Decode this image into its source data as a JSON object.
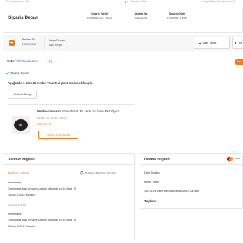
{
  "topbar": {
    "left": "Tüm Siparişlerine Dön",
    "middle": "Siparişini Göle",
    "right": "Hesaplı Sanş Siparişlerinize Gi"
  },
  "page_title": "Sipariş Detayı",
  "summary": {
    "date_label": "Sipariş Tarihi",
    "date_value": "19 Aralık 2023 - 01:25",
    "order_no_label": "Sipariş No",
    "order_no_value": "905244749",
    "summary_label": "Sipariş Özeti",
    "summary_value": "1 Teslimat, 1 Ürün"
  },
  "package": {
    "delivery_no_label": "Teslimat No",
    "delivery_no_value": "3122087545",
    "carrier_label": "Kargo Firması",
    "carrier_value": "Aras Kargo",
    "return_button": "İade Talebi",
    "side_button": "Fa"
  },
  "seller": {
    "label": "Satıcı:",
    "name": "Modaadresiniz",
    "badge": "9,8",
    "action_badge": "Satı"
  },
  "status": {
    "text": "Teslim Edildi",
    "info": "Aşağıdaki 1 ürün 25 Aralık Pazartesi günü teslim edilmiştir.",
    "detail_button": "Teslimat Detay"
  },
  "product": {
    "brand": "Modaadresiniz",
    "title": "Uncharted 4: Bir Hırsızın Sonu Ps4 Oyun...",
    "attributes": "Beden: Gri, 40-46 - Adet: 1",
    "price": "199,90 TL",
    "evaluate_button": "Ürünü Değerlendir"
  },
  "delivery_info": {
    "heading": "Teslimat Bilgileri",
    "address_heading": "Teslimat Adresi",
    "update_link": "Teslimat Adresini Güncelle",
    "name": "emine kaya",
    "line1": "Dumlupınar Mah prevaze caddesi 48 sokak no 16 daire 19",
    "line2": "Gölcük 41000 / Kocaeli",
    "invoice_heading": "Fatura Adresi",
    "invoice_name": "emine kaya",
    "invoice_line1": "Dumlupınar Mah prevaze caddesi 48 sokak no 16 daire 19",
    "invoice_line2": "Gölcük 41000 / Kocaeli"
  },
  "payment": {
    "heading": "Ödeme Bilgileri",
    "card_mask": "*****",
    "row1": "Ürün Toplamı",
    "row2": "Kargo Tutarı",
    "row3": "100 TL ve Üzeri Kargo Bedava (Satıcı Karşılar)",
    "total": "Toplam"
  }
}
